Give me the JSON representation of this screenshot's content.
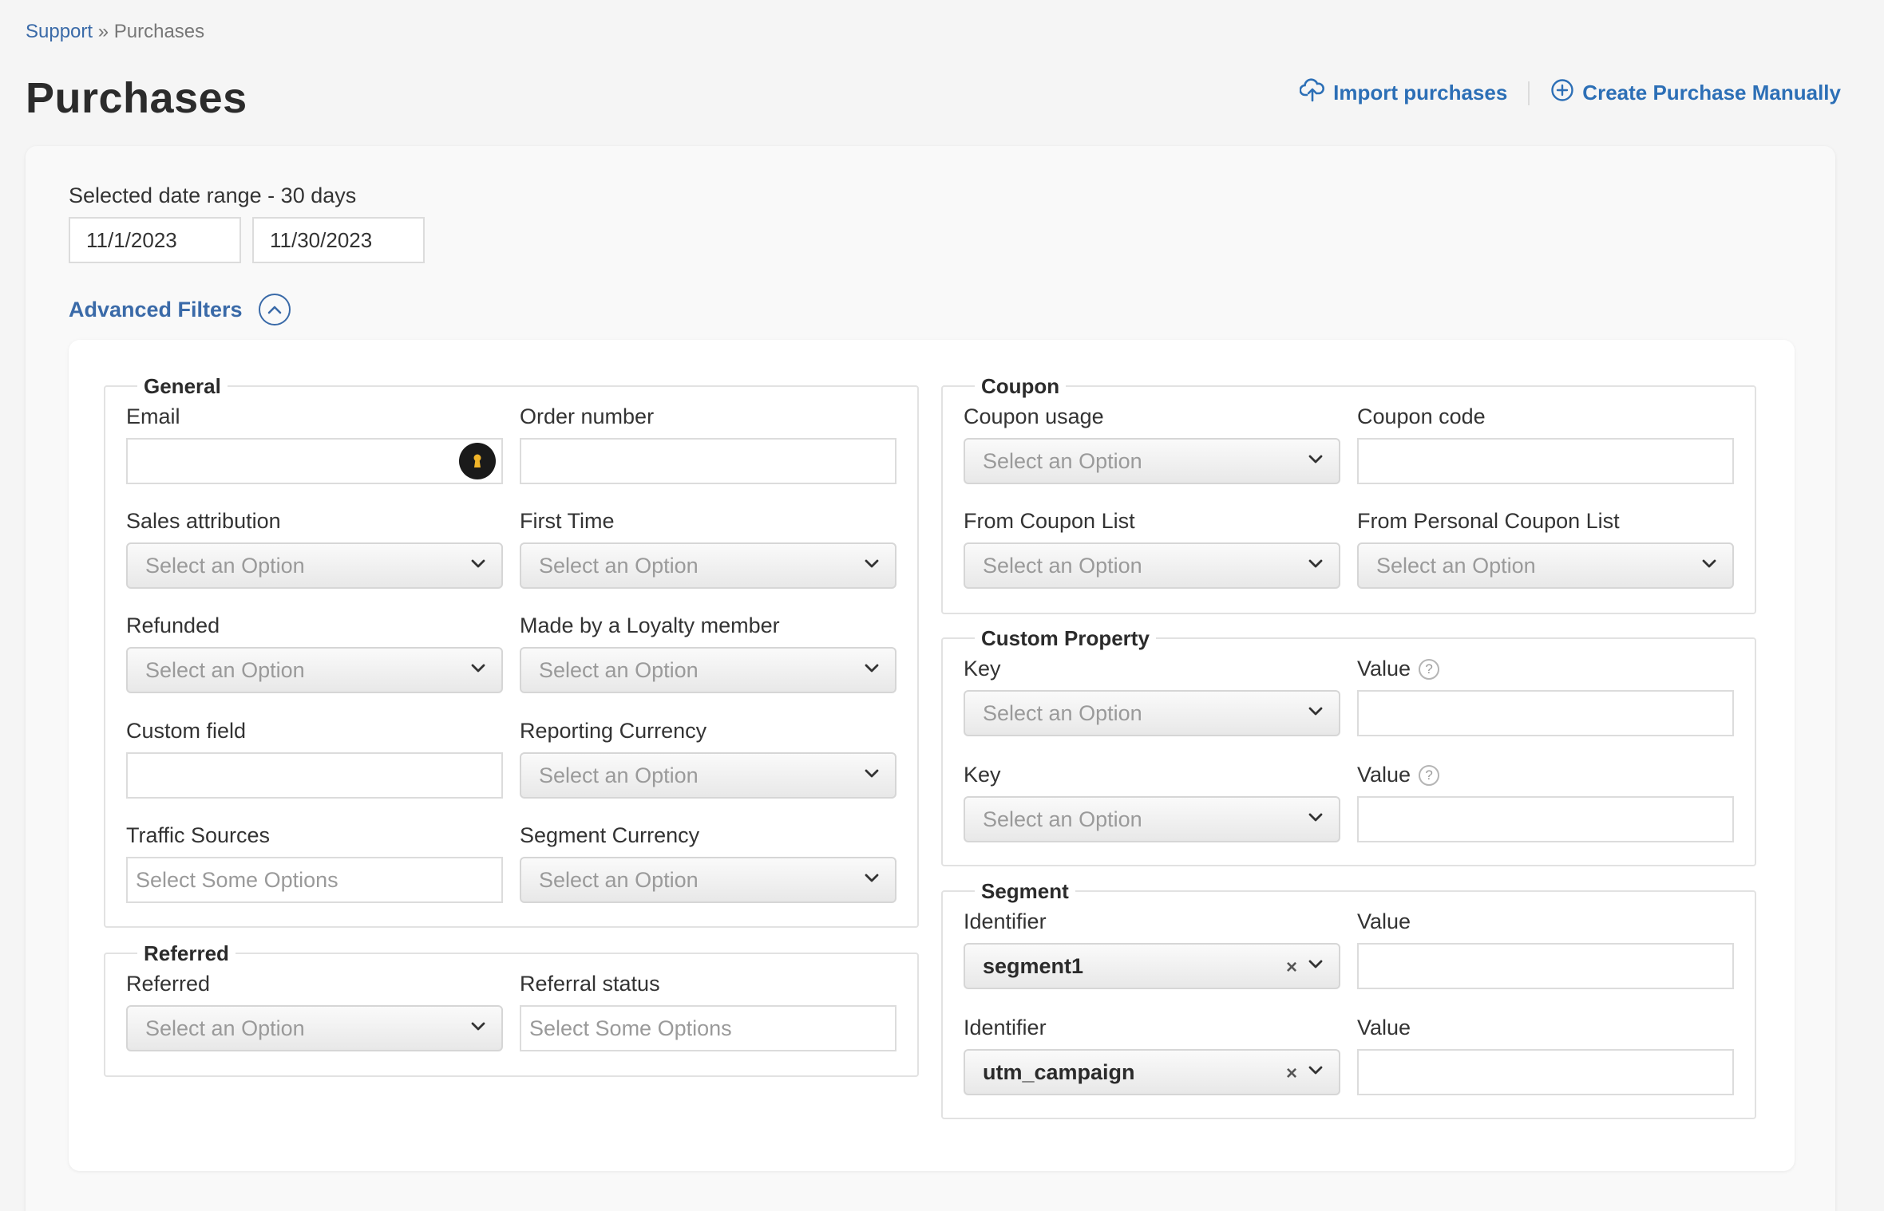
{
  "breadcrumb": {
    "root": "Support",
    "sep": " » ",
    "current": "Purchases"
  },
  "page": {
    "title": "Purchases"
  },
  "actions": {
    "import": "Import purchases",
    "create": "Create Purchase Manually"
  },
  "date_range": {
    "label": "Selected date range - 30 days",
    "start": "11/1/2023",
    "end": "11/30/2023"
  },
  "advanced": {
    "label": "Advanced Filters"
  },
  "general": {
    "legend": "General",
    "email": {
      "label": "Email",
      "value": ""
    },
    "order_number": {
      "label": "Order number",
      "value": ""
    },
    "sales_attribution": {
      "label": "Sales attribution",
      "value": "Select an Option"
    },
    "first_time": {
      "label": "First Time",
      "value": "Select an Option"
    },
    "refunded": {
      "label": "Refunded",
      "value": "Select an Option"
    },
    "loyalty": {
      "label": "Made by a Loyalty member",
      "value": "Select an Option"
    },
    "custom_field": {
      "label": "Custom field",
      "value": ""
    },
    "reporting_currency": {
      "label": "Reporting Currency",
      "value": "Select an Option"
    },
    "traffic_sources": {
      "label": "Traffic Sources",
      "placeholder": "Select Some Options"
    },
    "segment_currency": {
      "label": "Segment Currency",
      "value": "Select an Option"
    }
  },
  "referred": {
    "legend": "Referred",
    "referred": {
      "label": "Referred",
      "value": "Select an Option"
    },
    "referral_status": {
      "label": "Referral status",
      "placeholder": "Select Some Options"
    }
  },
  "coupon": {
    "legend": "Coupon",
    "usage": {
      "label": "Coupon usage",
      "value": "Select an Option"
    },
    "code": {
      "label": "Coupon code",
      "value": ""
    },
    "from_list": {
      "label": "From Coupon List",
      "value": "Select an Option"
    },
    "from_personal": {
      "label": "From Personal Coupon List",
      "value": "Select an Option"
    }
  },
  "custom_property": {
    "legend": "Custom Property",
    "rows": [
      {
        "key_label": "Key",
        "key_value": "Select an Option",
        "value_label": "Value"
      },
      {
        "key_label": "Key",
        "key_value": "Select an Option",
        "value_label": "Value"
      }
    ]
  },
  "segment": {
    "legend": "Segment",
    "rows": [
      {
        "id_label": "Identifier",
        "id_value": "segment1",
        "value_label": "Value"
      },
      {
        "id_label": "Identifier",
        "id_value": "utm_campaign",
        "value_label": "Value"
      }
    ]
  },
  "glyphs": {
    "clear": "×",
    "help": "?"
  },
  "icons": {
    "import": "cloud-upload-icon",
    "create": "plus-circle-icon",
    "toggle": "chevron-up-icon",
    "dropdown": "chevron-down-icon",
    "password_manager": "keyhole-icon"
  },
  "colors": {
    "link": "#3a6aa8",
    "action": "#2c6fb6",
    "background": "#f5f5f5"
  }
}
